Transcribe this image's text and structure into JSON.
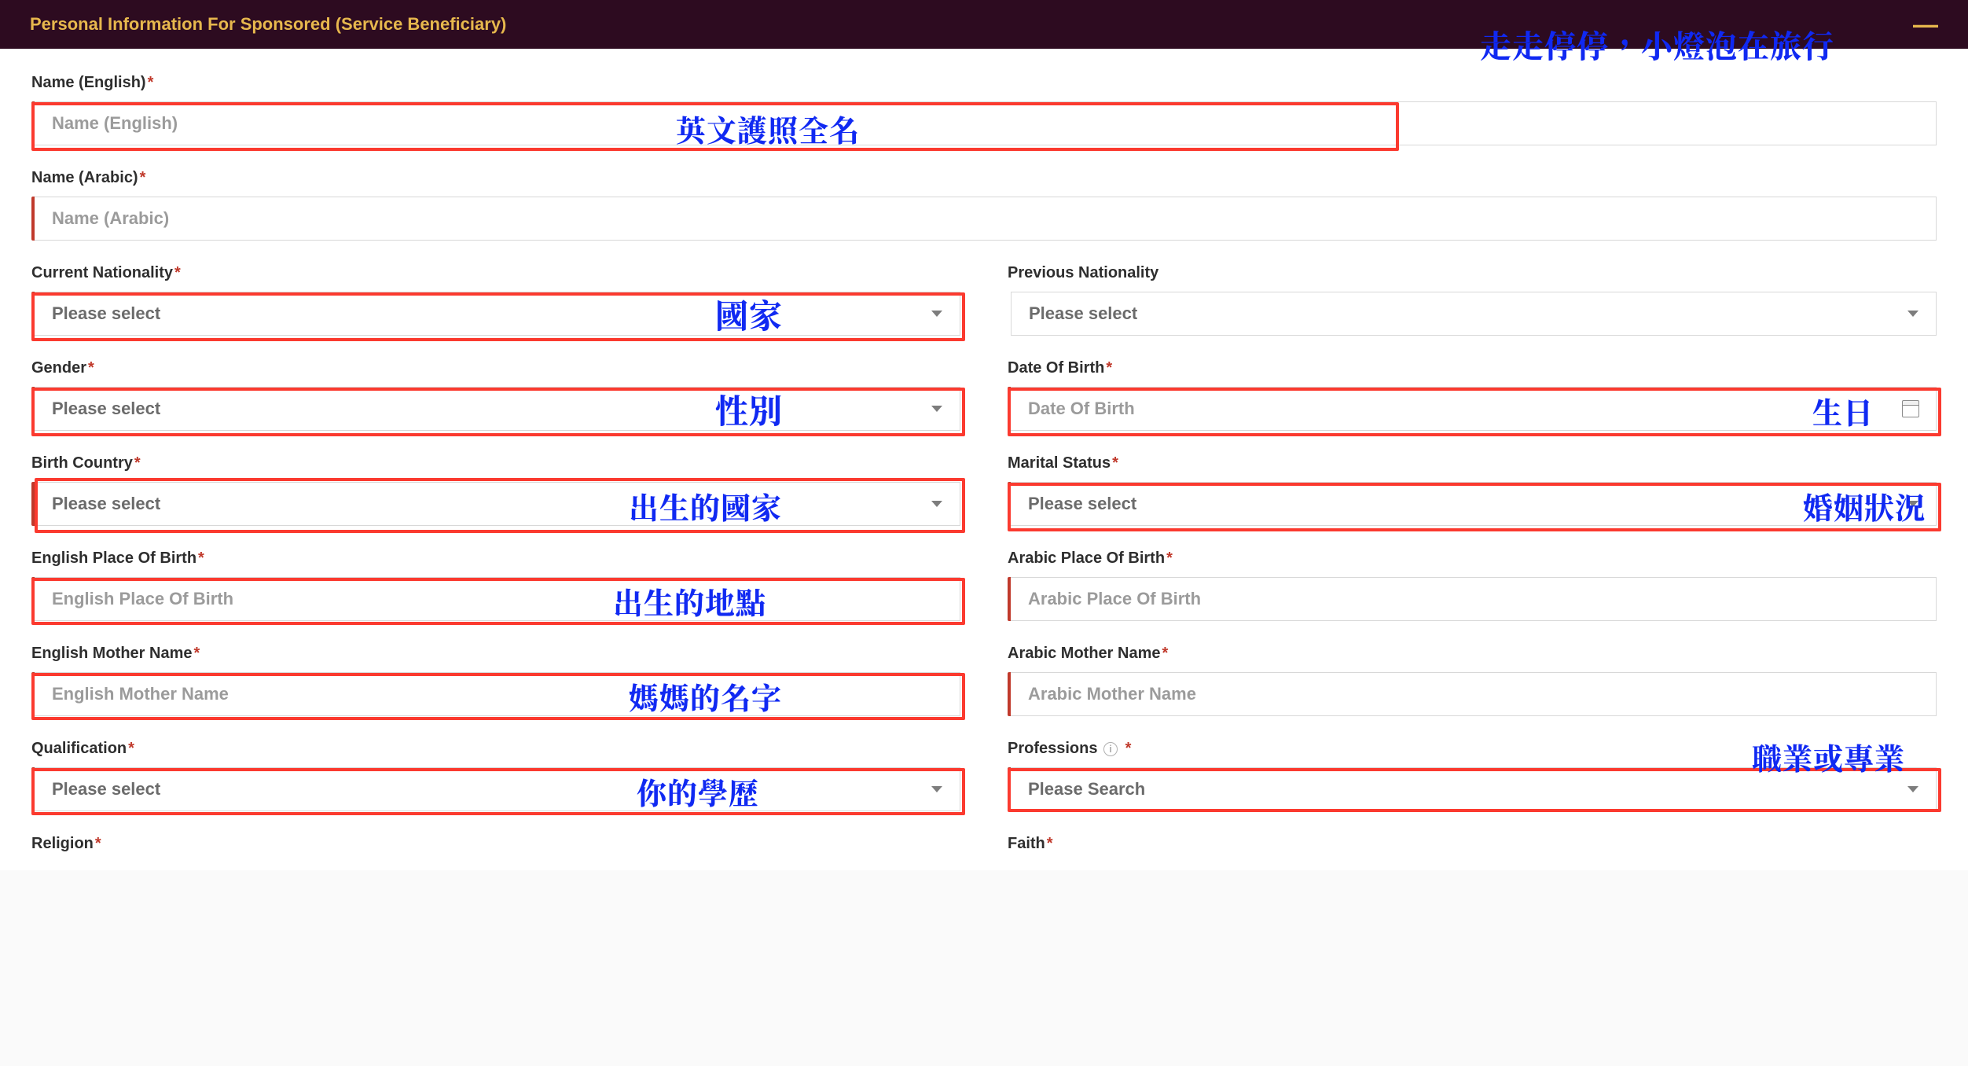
{
  "header": {
    "title": "Personal Information For Sponsored (Service Beneficiary)"
  },
  "watermark": "走走停停，小燈泡在旅行",
  "fields": {
    "name_en": {
      "label": "Name (English)",
      "placeholder": "Name (English)"
    },
    "name_ar": {
      "label": "Name (Arabic)",
      "placeholder": "Name (Arabic)"
    },
    "cur_nat": {
      "label": "Current Nationality",
      "placeholder": "Please select"
    },
    "prev_nat": {
      "label": "Previous Nationality",
      "placeholder": "Please select"
    },
    "gender": {
      "label": "Gender",
      "placeholder": "Please select"
    },
    "dob": {
      "label": "Date Of Birth",
      "placeholder": "Date Of Birth"
    },
    "birth_country": {
      "label": "Birth Country",
      "placeholder": "Please select"
    },
    "marital": {
      "label": "Marital Status",
      "placeholder": "Please select"
    },
    "pob_en": {
      "label": "English Place Of Birth",
      "placeholder": "English Place Of Birth"
    },
    "pob_ar": {
      "label": "Arabic Place Of Birth",
      "placeholder": "Arabic Place Of Birth"
    },
    "mother_en": {
      "label": "English Mother Name",
      "placeholder": "English Mother Name"
    },
    "mother_ar": {
      "label": "Arabic Mother Name",
      "placeholder": "Arabic Mother Name"
    },
    "qual": {
      "label": "Qualification",
      "placeholder": "Please select"
    },
    "prof": {
      "label": "Professions",
      "placeholder": "Please Search"
    },
    "religion": {
      "label": "Religion"
    },
    "faith": {
      "label": "Faith"
    }
  },
  "annotations": {
    "name_en": "英文護照全名",
    "cur_nat": "國家",
    "gender": "性別",
    "dob": "生日",
    "birth_country": "出生的國家",
    "marital": "婚姻狀況",
    "pob_en": "出生的地點",
    "mother_en": "媽媽的名字",
    "qual": "你的學歷",
    "prof": "職業或專業"
  }
}
